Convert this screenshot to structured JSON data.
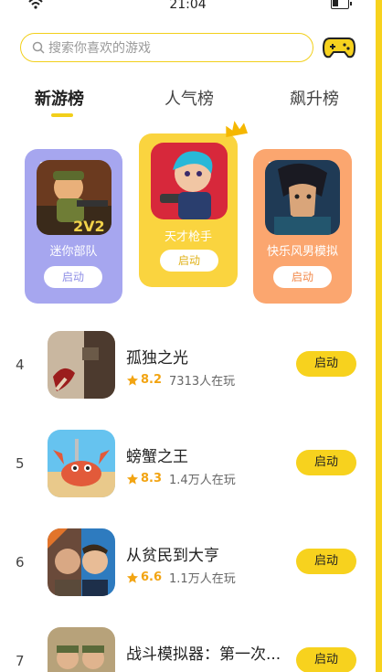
{
  "status_bar": {
    "time": "21:04"
  },
  "search": {
    "placeholder": "搜索你喜欢的游戏"
  },
  "tabs": [
    {
      "label": "新游榜",
      "active": true
    },
    {
      "label": "人气榜",
      "active": false
    },
    {
      "label": "飙升榜",
      "active": false
    }
  ],
  "podium": [
    {
      "rank": "2",
      "name": "迷你部队",
      "button": "启动",
      "color": "#a6a6ef"
    },
    {
      "rank": "1",
      "name": "天才枪手",
      "button": "启动",
      "color": "#fad43f"
    },
    {
      "rank": "3",
      "name": "快乐风男模拟",
      "button": "启动",
      "color": "#fba66f"
    }
  ],
  "list": [
    {
      "rank": "4",
      "title": "孤独之光",
      "score": "8.2",
      "players": "7313人在玩",
      "button": "启动"
    },
    {
      "rank": "5",
      "title": "螃蟹之王",
      "score": "8.3",
      "players": "1.4万人在玩",
      "button": "启动"
    },
    {
      "rank": "6",
      "title": "从贫民到大亨",
      "score": "6.6",
      "players": "1.1万人在玩",
      "button": "启动"
    },
    {
      "rank": "7",
      "title": "战斗模拟器：第一次...",
      "score": "",
      "players": "",
      "button": "启动"
    }
  ],
  "colors": {
    "accent": "#f7d21e",
    "star": "#f2a412"
  }
}
